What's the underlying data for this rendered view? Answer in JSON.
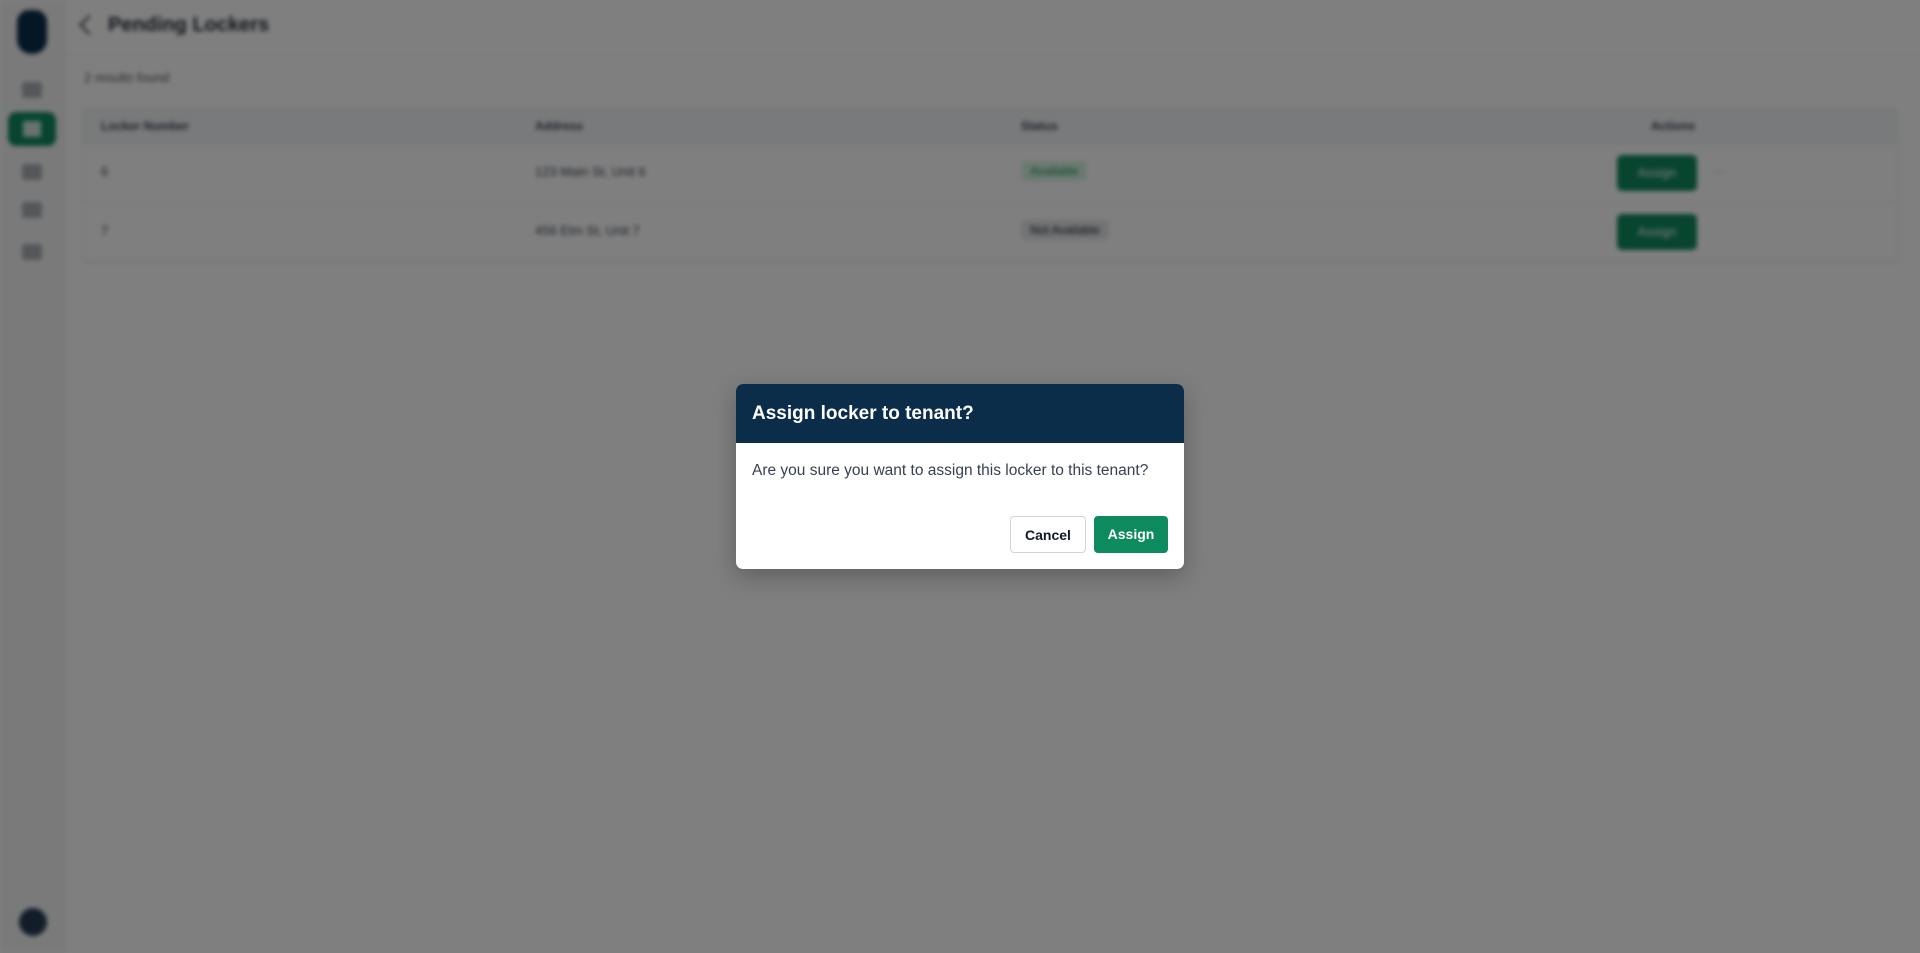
{
  "page": {
    "title": "Pending Lockers",
    "subtitle": "2 results found"
  },
  "table": {
    "headers": [
      "Locker Number",
      "Address",
      "Status",
      "Actions"
    ],
    "rows": [
      {
        "locker": "6",
        "address": "123 Main St, Unit 6",
        "status": "Available",
        "action": "Assign"
      },
      {
        "locker": "7",
        "address": "456 Elm St, Unit 7",
        "status": "Not Available",
        "action": "Assign"
      }
    ]
  },
  "modal": {
    "title": "Assign locker to tenant?",
    "message": "Are you sure you want to assign this locker to this tenant?",
    "cancel_label": "Cancel",
    "confirm_label": "Assign"
  },
  "colors": {
    "header_navy": "#0b2d4a",
    "accent_green": "#0e8a5f"
  }
}
